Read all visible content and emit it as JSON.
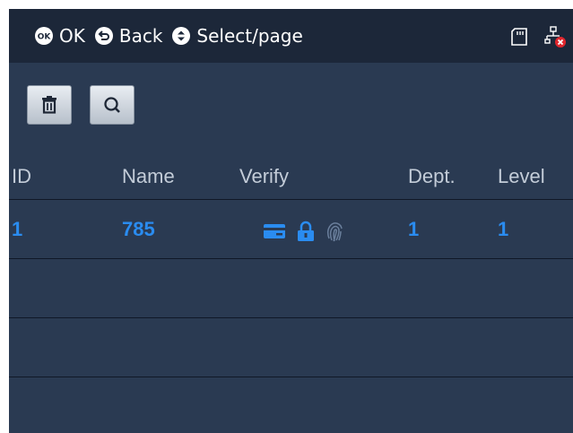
{
  "topbar": {
    "hints": [
      {
        "icon": "ok-key-icon",
        "label": "OK"
      },
      {
        "icon": "back-key-icon",
        "label": "Back"
      },
      {
        "icon": "updown-key-icon",
        "label": "Select/page"
      }
    ],
    "status_icons": [
      "sd-card-icon",
      "network-disconnected-icon"
    ]
  },
  "toolbar": {
    "buttons": [
      {
        "icon": "trash-icon"
      },
      {
        "icon": "search-icon"
      }
    ]
  },
  "table": {
    "columns": [
      "ID",
      "Name",
      "Verify",
      "Dept.",
      "Level"
    ],
    "rows": [
      {
        "id": "1",
        "name": "785",
        "verify": [
          "card-icon",
          "lock-icon",
          "fingerprint-icon"
        ],
        "dept": "1",
        "level": "1"
      }
    ]
  },
  "colors": {
    "background": "#2a3a52",
    "topbar": "#1c2739",
    "accent": "#2a8cf0",
    "header_text": "#c3ccd8"
  }
}
